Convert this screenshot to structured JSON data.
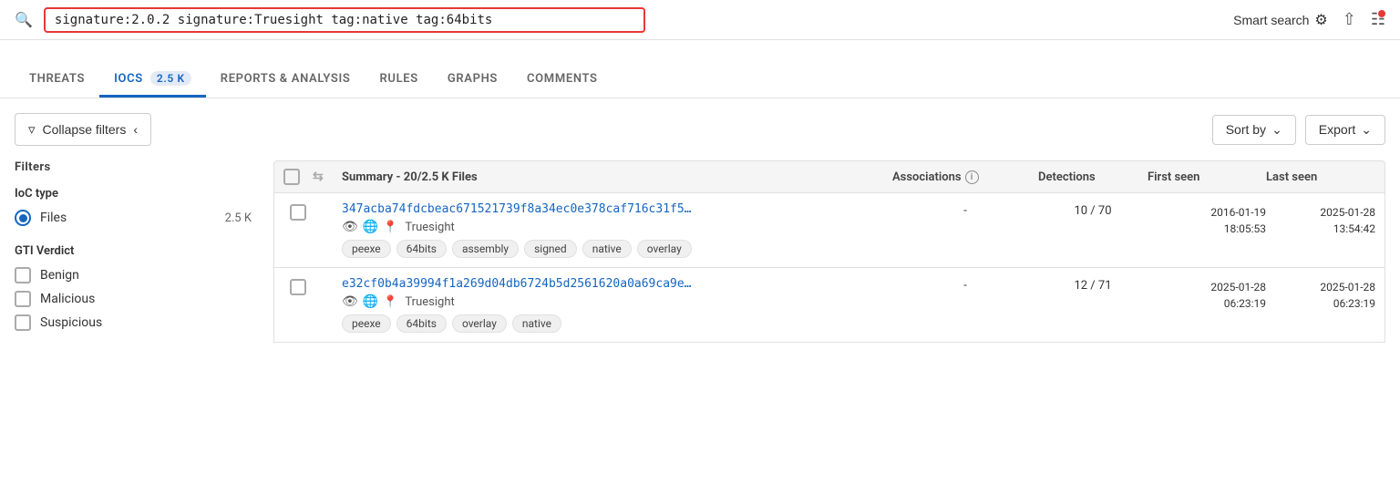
{
  "topbar": {
    "search_value": "signature:2.0.2 signature:Truesight tag:native tag:64bits",
    "smart_search_label": "Smart search"
  },
  "tabs": [
    {
      "id": "threats",
      "label": "THREATS",
      "active": false,
      "badge": null
    },
    {
      "id": "iocs",
      "label": "IOCS",
      "active": true,
      "badge": "2.5 K"
    },
    {
      "id": "reports",
      "label": "REPORTS & ANALYSIS",
      "active": false,
      "badge": null
    },
    {
      "id": "rules",
      "label": "RULES",
      "active": false,
      "badge": null
    },
    {
      "id": "graphs",
      "label": "GRAPHS",
      "active": false,
      "badge": null
    },
    {
      "id": "comments",
      "label": "COMMENTS",
      "active": false,
      "badge": null
    }
  ],
  "toolbar": {
    "collapse_filters_label": "Collapse filters",
    "sort_by_label": "Sort by",
    "export_label": "Export"
  },
  "filters": {
    "title": "Filters",
    "ioc_type": {
      "label": "IoC type",
      "options": [
        {
          "label": "Files",
          "count": "2.5 K",
          "selected": true
        }
      ]
    },
    "gti_verdict": {
      "label": "GTI Verdict",
      "options": [
        {
          "label": "Benign",
          "selected": false
        },
        {
          "label": "Malicious",
          "selected": false
        },
        {
          "label": "Suspicious",
          "selected": false
        }
      ]
    }
  },
  "results": {
    "summary_label": "Summary - 20/2.5 K Files",
    "columns": {
      "associations": "Associations",
      "detections": "Detections",
      "first_seen": "First seen",
      "last_seen": "Last seen"
    },
    "rows": [
      {
        "hash": "347acba74fdcbeac671521739f8a34ec0e378caf716c31f5…",
        "source": "Truesight",
        "associations": "-",
        "detections": "10 / 70",
        "first_seen_date": "2016-01-19",
        "first_seen_time": "18:05:53",
        "last_seen_date": "2025-01-28",
        "last_seen_time": "13:54:42",
        "tags": [
          "peexe",
          "64bits",
          "assembly",
          "signed",
          "native",
          "overlay"
        ]
      },
      {
        "hash": "e32cf0b4a39994f1a269d04db6724b5d2561620a0a69ca9e…",
        "source": "Truesight",
        "associations": "-",
        "detections": "12 / 71",
        "first_seen_date": "2025-01-28",
        "first_seen_time": "06:23:19",
        "last_seen_date": "2025-01-28",
        "last_seen_time": "06:23:19",
        "tags": [
          "peexe",
          "64bits",
          "overlay",
          "native"
        ]
      }
    ]
  }
}
